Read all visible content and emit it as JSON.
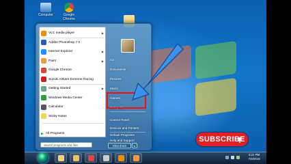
{
  "desktop": {
    "icons": [
      {
        "label": "Computer",
        "icon": "computer-icon"
      },
      {
        "label": "Google Chrome",
        "icon": "chrome-icon"
      },
      {
        "label": "",
        "icon": "folder-icon"
      }
    ]
  },
  "start_menu": {
    "pinned": [
      {
        "label": "VLC media player",
        "icon": "vlc-icon",
        "color": "#f28c00",
        "has_arrow": true
      },
      {
        "label": "Adobe Photoshop 7.0",
        "icon": "photoshop-icon",
        "color": "#2a5fb0",
        "has_arrow": false
      },
      {
        "label": "Internet Explorer",
        "icon": "internet-explorer-icon",
        "color": "#1e90ff",
        "has_arrow": true
      },
      {
        "label": "Paint",
        "icon": "paint-icon",
        "color": "#e94",
        "has_arrow": true
      },
      {
        "label": "Google Chrome",
        "icon": "chrome-icon",
        "color": "#dd4433",
        "has_arrow": false
      },
      {
        "label": "Suzuki Alstare Extreme Racing",
        "icon": "racing-game-icon",
        "color": "#c22",
        "has_arrow": false
      },
      {
        "label": "Getting Started",
        "icon": "getting-started-icon",
        "color": "#6a8",
        "has_arrow": true
      },
      {
        "label": "Windows Media Center",
        "icon": "media-center-icon",
        "color": "#2b9d3a",
        "has_arrow": false
      },
      {
        "label": "Calculator",
        "icon": "calculator-icon",
        "color": "#556",
        "has_arrow": false
      },
      {
        "label": "Sticky Notes",
        "icon": "sticky-notes-icon",
        "color": "#e8d84a",
        "has_arrow": false
      }
    ],
    "all_programs": "All Programs",
    "search_placeholder": "Search programs and files",
    "right_items": [
      {
        "label": "A3"
      },
      {
        "label": "Documents"
      },
      {
        "label": "Pictures"
      },
      {
        "label": "Music"
      },
      {
        "label": "Games"
      },
      {
        "label": "Computer"
      },
      {
        "label": "Control Panel"
      },
      {
        "label": "Devices and Printers"
      },
      {
        "label": "Default Programs"
      },
      {
        "label": "Help and Support"
      }
    ],
    "shutdown_label": "Shut down",
    "highlight_color": "#ee1111"
  },
  "overlay": {
    "subscribe_label": "SUBSCRIBE",
    "subscribe_color": "#e21f25",
    "arrow_color": "#2b8cf0"
  },
  "taskbar": {
    "time": "3:21 PM",
    "date": "7/3/2019",
    "apps": [
      "explorer-icon",
      "folder-icon",
      "chrome-icon",
      "media-player-icon",
      "vlc-icon",
      "paint-icon"
    ]
  }
}
